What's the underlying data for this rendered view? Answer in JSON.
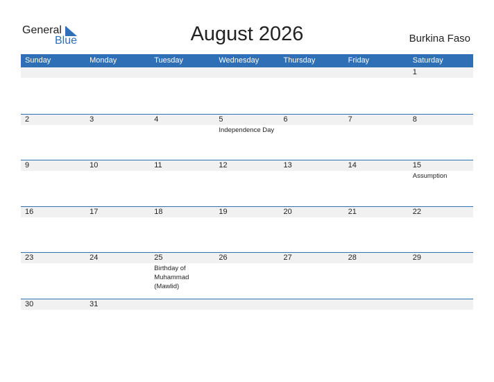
{
  "logo": {
    "part1": "General",
    "part2": "Blue"
  },
  "title": "August 2026",
  "country": "Burkina Faso",
  "weekdays": [
    "Sunday",
    "Monday",
    "Tuesday",
    "Wednesday",
    "Thursday",
    "Friday",
    "Saturday"
  ],
  "weeks": [
    [
      {
        "d": ""
      },
      {
        "d": ""
      },
      {
        "d": ""
      },
      {
        "d": ""
      },
      {
        "d": ""
      },
      {
        "d": ""
      },
      {
        "d": "1"
      }
    ],
    [
      {
        "d": "2"
      },
      {
        "d": "3"
      },
      {
        "d": "4"
      },
      {
        "d": "5",
        "e": "Independence Day"
      },
      {
        "d": "6"
      },
      {
        "d": "7"
      },
      {
        "d": "8"
      }
    ],
    [
      {
        "d": "9"
      },
      {
        "d": "10"
      },
      {
        "d": "11"
      },
      {
        "d": "12"
      },
      {
        "d": "13"
      },
      {
        "d": "14"
      },
      {
        "d": "15",
        "e": "Assumption"
      }
    ],
    [
      {
        "d": "16"
      },
      {
        "d": "17"
      },
      {
        "d": "18"
      },
      {
        "d": "19"
      },
      {
        "d": "20"
      },
      {
        "d": "21"
      },
      {
        "d": "22"
      }
    ],
    [
      {
        "d": "23"
      },
      {
        "d": "24"
      },
      {
        "d": "25",
        "e": "Birthday of Muhammad (Mawlid)"
      },
      {
        "d": "26"
      },
      {
        "d": "27"
      },
      {
        "d": "28"
      },
      {
        "d": "29"
      }
    ],
    [
      {
        "d": "30"
      },
      {
        "d": "31"
      },
      {
        "d": ""
      },
      {
        "d": ""
      },
      {
        "d": ""
      },
      {
        "d": ""
      },
      {
        "d": ""
      }
    ]
  ]
}
